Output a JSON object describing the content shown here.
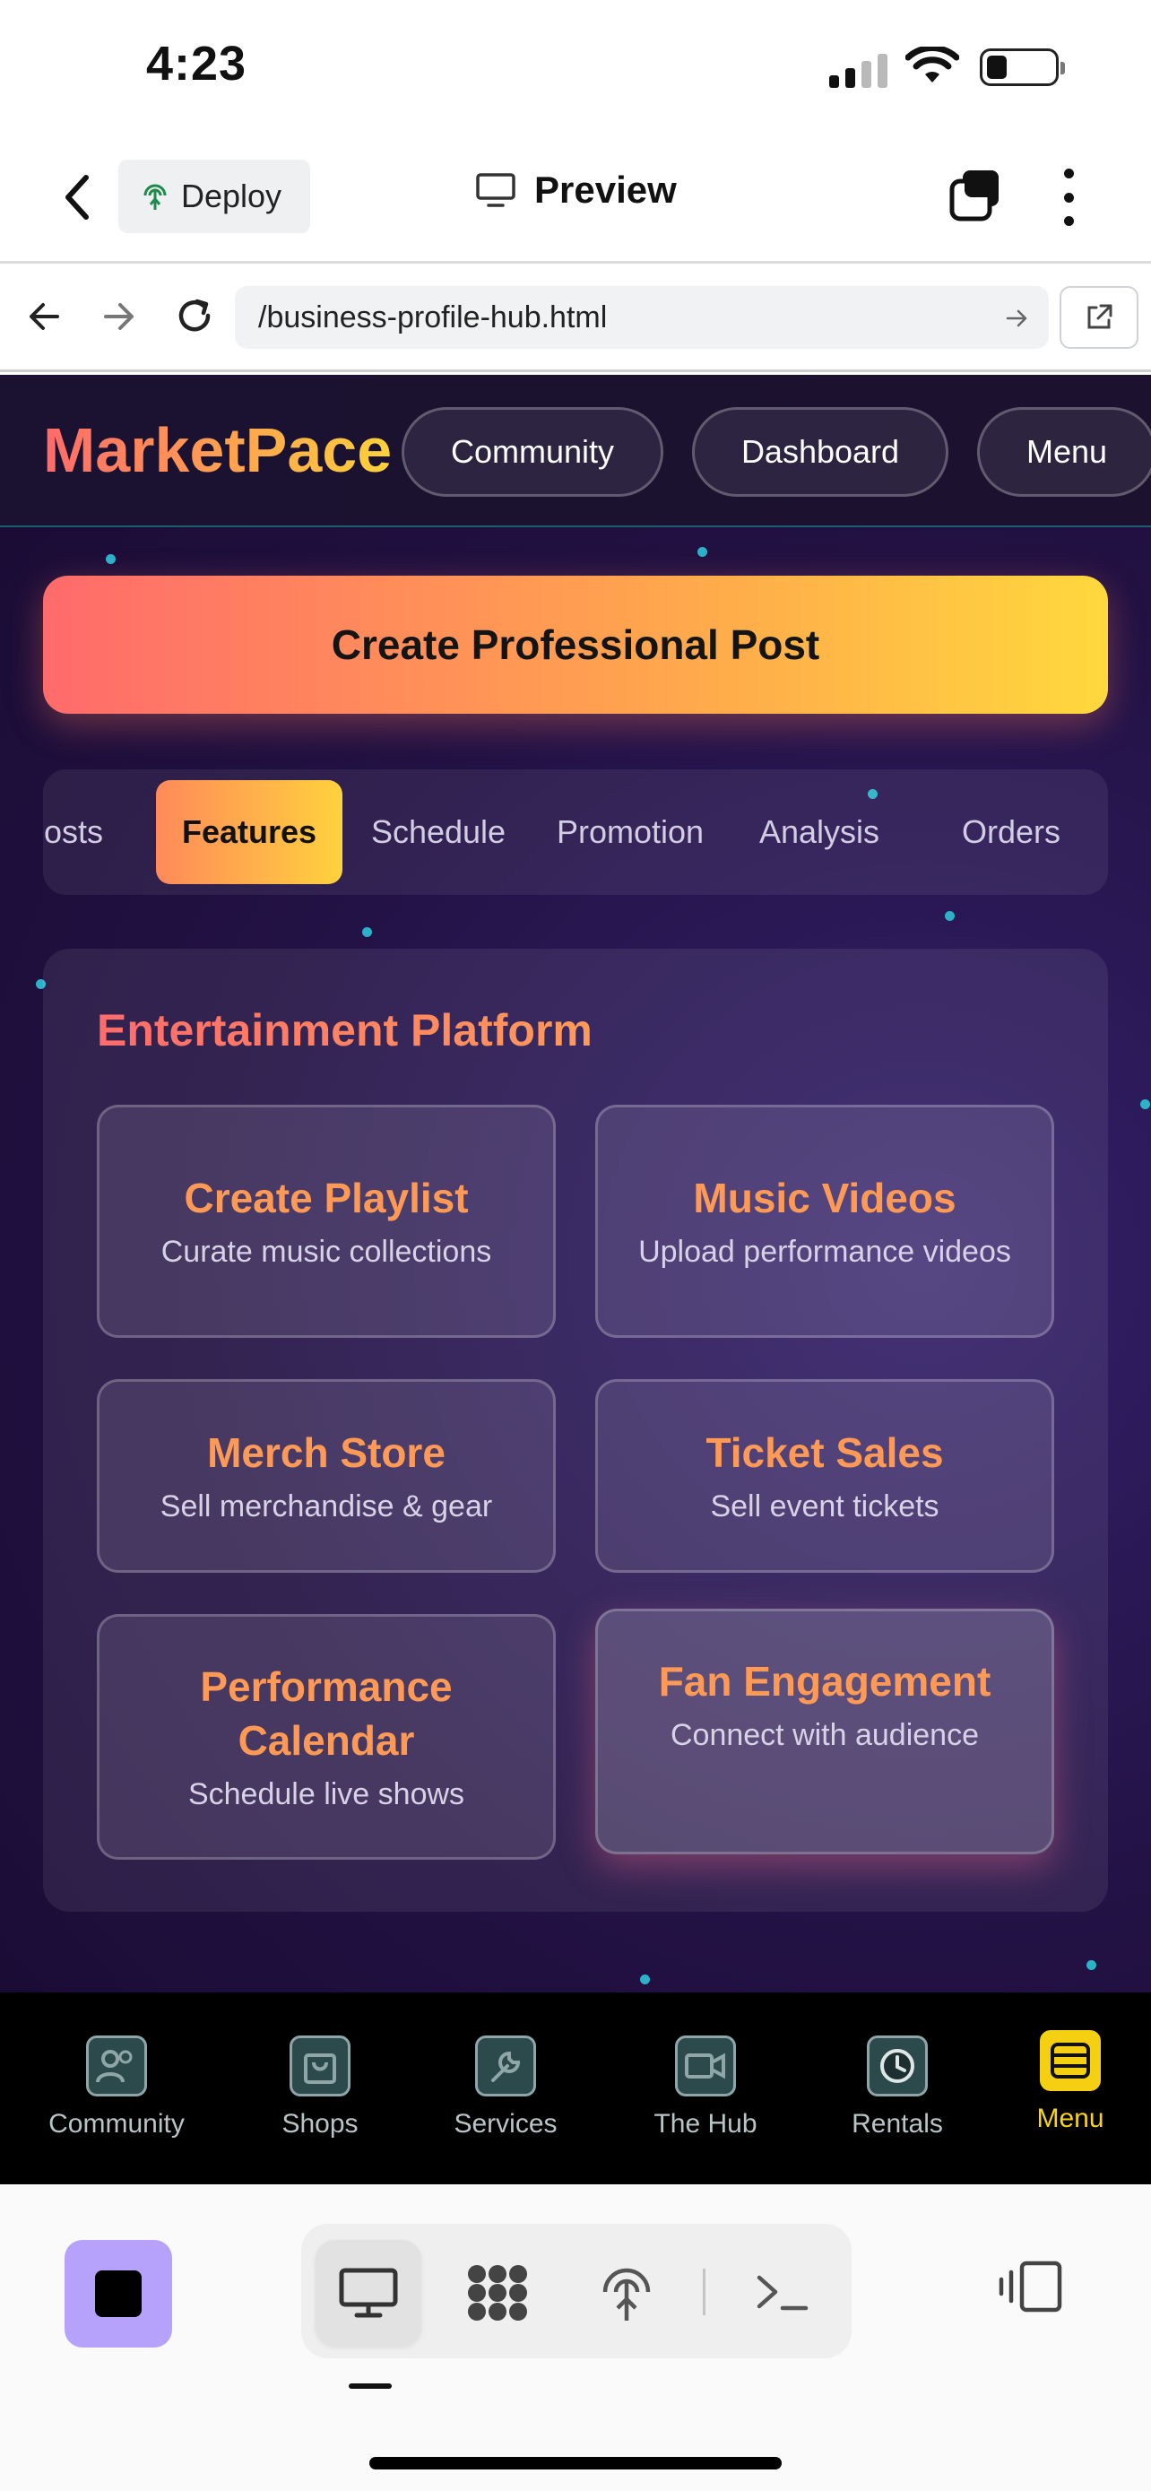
{
  "status": {
    "time": "4:23"
  },
  "app_bar": {
    "deploy_label": "Deploy",
    "preview_label": "Preview"
  },
  "browser": {
    "url": "/business-profile-hub.html"
  },
  "site": {
    "brand": "MarketPace",
    "header_buttons": [
      "Community",
      "Dashboard",
      "Menu"
    ],
    "create_post_label": "Create Professional Post",
    "tabs": [
      "osts",
      "Features",
      "Schedule",
      "Promotion",
      "Analysis",
      "Orders"
    ],
    "active_tab": "Features",
    "panel_title": "Entertainment Platform",
    "cards": [
      {
        "title": "Create Playlist",
        "desc": "Curate music collections"
      },
      {
        "title": "Music Videos",
        "desc": "Upload performance videos"
      },
      {
        "title": "Merch Store",
        "desc": "Sell merchandise & gear"
      },
      {
        "title": "Ticket Sales",
        "desc": "Sell event tickets"
      },
      {
        "title": "Performance Calendar",
        "desc": "Schedule live shows"
      },
      {
        "title": "Fan Engagement",
        "desc": "Connect with audience"
      }
    ],
    "bottom_nav": [
      {
        "label": "Community",
        "icon": "people-icon"
      },
      {
        "label": "Shops",
        "icon": "shopping-bag-icon"
      },
      {
        "label": "Services",
        "icon": "wrench-icon"
      },
      {
        "label": "The Hub",
        "icon": "video-camera-icon"
      },
      {
        "label": "Rentals",
        "icon": "clock-icon"
      },
      {
        "label": "Menu",
        "icon": "menu-icon",
        "active": true
      }
    ]
  },
  "colors": {
    "accent_gradient_start": "#ff6b6b",
    "accent_gradient_end": "#ffd83d",
    "card_title": "#ff9a56",
    "nav_active": "#f7d31a",
    "stop_button": "#b7a2fb"
  }
}
